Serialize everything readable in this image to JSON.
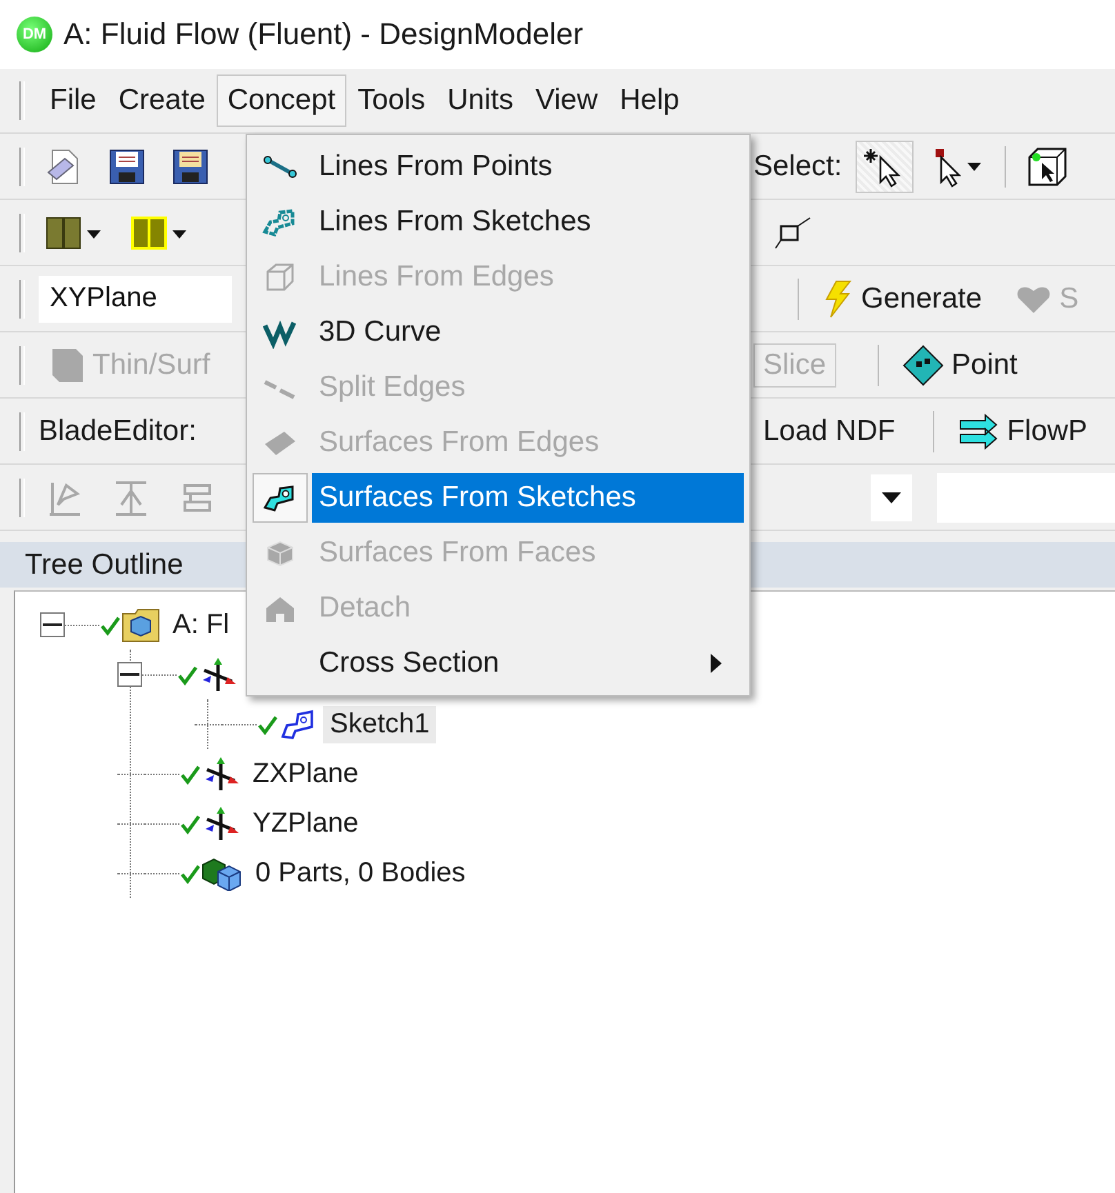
{
  "window": {
    "logo_text": "DM",
    "title": "A: Fluid Flow (Fluent) - DesignModeler"
  },
  "menu_bar": [
    {
      "label": "File",
      "selected": false
    },
    {
      "label": "Create",
      "selected": false
    },
    {
      "label": "Concept",
      "selected": true
    },
    {
      "label": "Tools",
      "selected": false
    },
    {
      "label": "Units",
      "selected": false
    },
    {
      "label": "View",
      "selected": false
    },
    {
      "label": "Help",
      "selected": false
    }
  ],
  "toolbars": {
    "select_label": "Select:",
    "select_modes": [
      {
        "selected": true
      },
      {
        "selected": false
      }
    ],
    "plane_field": {
      "value": "XYPlane"
    },
    "generate_button": {
      "label": "Generate",
      "disabled": false
    },
    "cut_button": {
      "label": "S",
      "disabled": true
    },
    "thin_button": {
      "label": "Thin/Surf",
      "disabled": true
    },
    "slice_button": {
      "label": "Slice",
      "disabled": true
    },
    "point_button": {
      "label": "Point",
      "disabled": false
    },
    "blade_label": "BladeEditor:",
    "load_button": {
      "label": "Load NDF",
      "disabled": false
    },
    "flow_button": {
      "label": "FlowP",
      "disabled": false
    },
    "sketch_tools": [
      {
        "disabled": true
      },
      {
        "disabled": true
      },
      {
        "disabled": true
      }
    ]
  },
  "menu": {
    "items": [
      {
        "label": "Lines From Points",
        "disabled": false,
        "selected": false,
        "submenu": false
      },
      {
        "label": "Lines From Sketches",
        "disabled": false,
        "selected": false,
        "submenu": false
      },
      {
        "label": "Lines From Edges",
        "disabled": true,
        "selected": false,
        "submenu": false
      },
      {
        "label": "3D Curve",
        "disabled": false,
        "selected": false,
        "submenu": false
      },
      {
        "label": "Split Edges",
        "disabled": true,
        "selected": false,
        "submenu": false
      },
      {
        "label": "Surfaces From Edges",
        "disabled": true,
        "selected": false,
        "submenu": false
      },
      {
        "label": "Surfaces From Sketches",
        "disabled": false,
        "selected": true,
        "submenu": false
      },
      {
        "label": "Surfaces From Faces",
        "disabled": true,
        "selected": false,
        "submenu": false
      },
      {
        "label": "Detach",
        "disabled": true,
        "selected": false,
        "submenu": false
      },
      {
        "label": "Cross Section",
        "disabled": false,
        "selected": false,
        "submenu": true
      }
    ]
  },
  "tree": {
    "title": "Tree Outline",
    "nodes": [
      {
        "kind": "model",
        "label": "A: Fl",
        "selected": false,
        "expanded": true,
        "children": [
          {
            "kind": "plane",
            "expanded": true,
            "children": [
              {
                "kind": "sketch",
                "label": "Sketch1",
                "selected": true
              }
            ]
          },
          {
            "kind": "plane",
            "label": "ZXPlane",
            "selected": false
          },
          {
            "kind": "plane",
            "label": "YZPlane",
            "selected": false
          },
          {
            "kind": "parts",
            "label": "0 Parts, 0 Bodies",
            "selected": false
          }
        ]
      }
    ]
  }
}
